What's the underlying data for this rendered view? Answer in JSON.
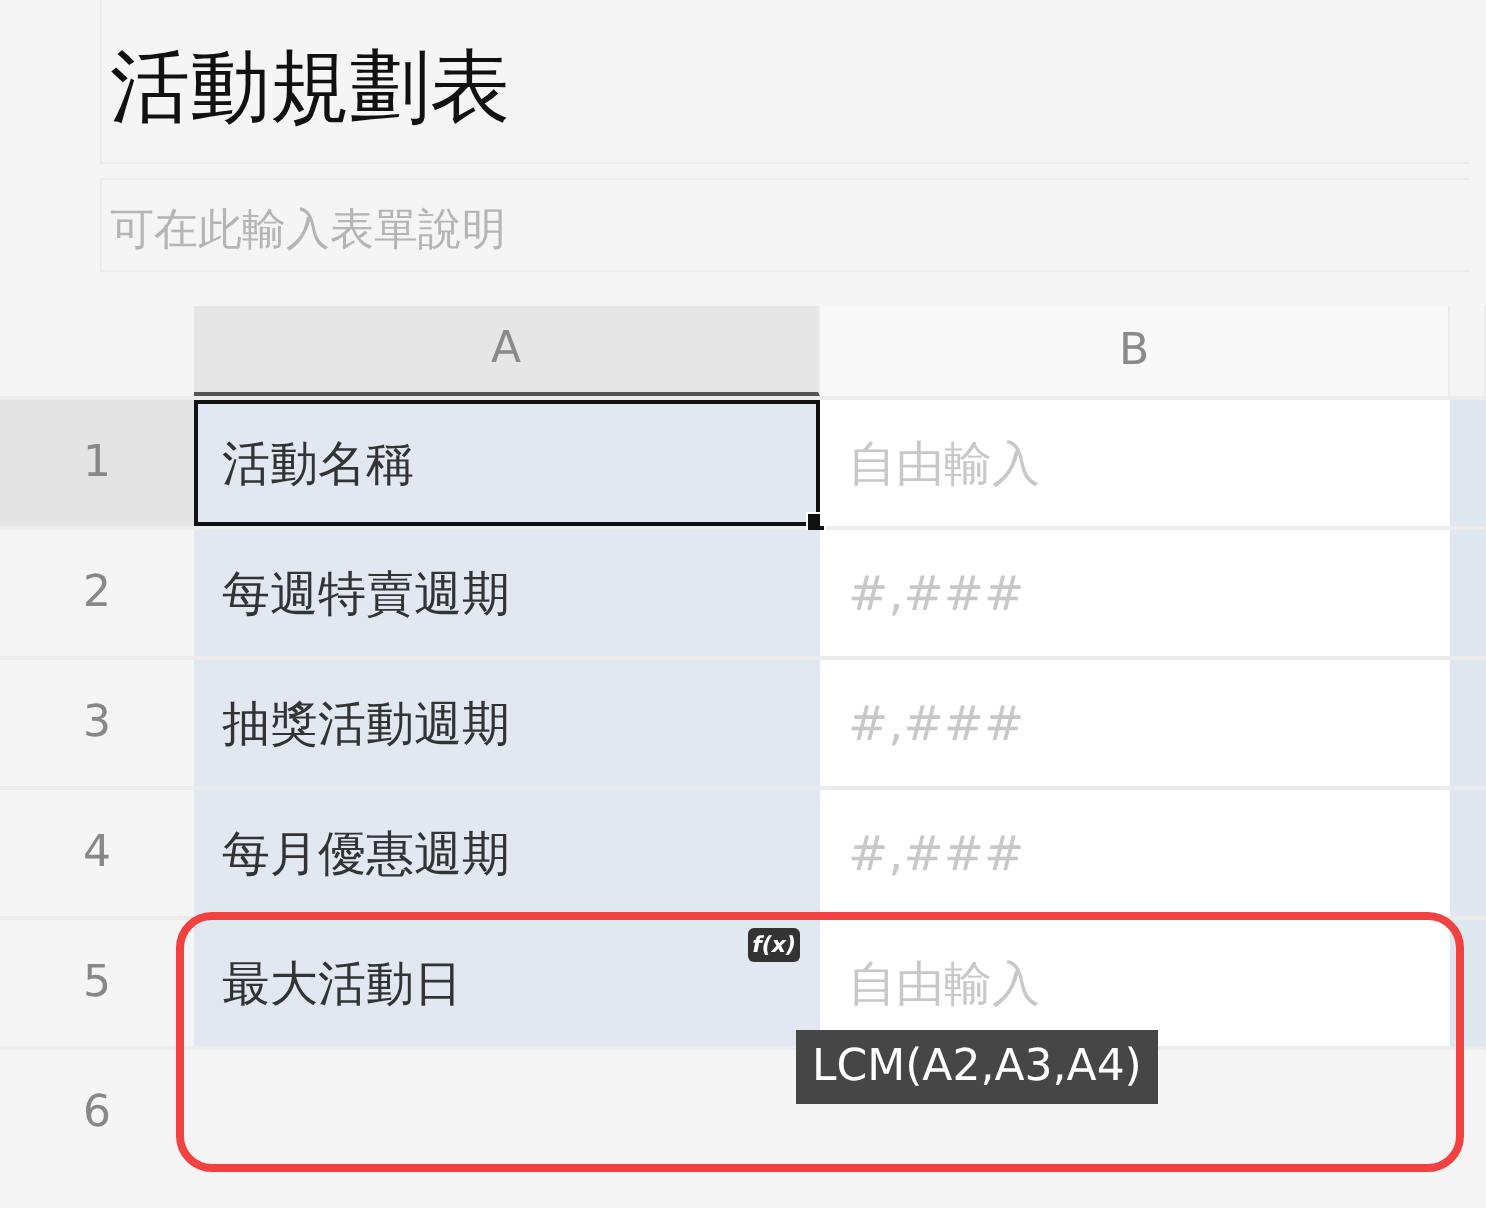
{
  "form": {
    "title": "活動規劃表",
    "description_placeholder": "可在此輸入表單說明"
  },
  "table": {
    "columns": [
      {
        "label": "A",
        "selected": true
      },
      {
        "label": "B",
        "selected": false
      }
    ],
    "rows": [
      {
        "number": "1",
        "selected": true,
        "label": "活動名稱",
        "input_placeholder": "自由輸入",
        "formula": false,
        "framed": false
      },
      {
        "number": "2",
        "selected": false,
        "label": "每週特賣週期",
        "input_placeholder": "#,###",
        "formula": false,
        "framed": false
      },
      {
        "number": "3",
        "selected": false,
        "label": "抽獎活動週期",
        "input_placeholder": "#,###",
        "formula": false,
        "framed": false
      },
      {
        "number": "4",
        "selected": false,
        "label": "每月優惠週期",
        "input_placeholder": "#,###",
        "formula": false,
        "framed": false
      },
      {
        "number": "5",
        "selected": false,
        "label": "最大活動日",
        "input_placeholder": "自由輸入",
        "formula": true,
        "framed": true
      },
      {
        "number": "6",
        "selected": false,
        "framed": true
      }
    ]
  },
  "formula_icon": "f(x)",
  "tooltip": "LCM(A2,A3,A4)"
}
